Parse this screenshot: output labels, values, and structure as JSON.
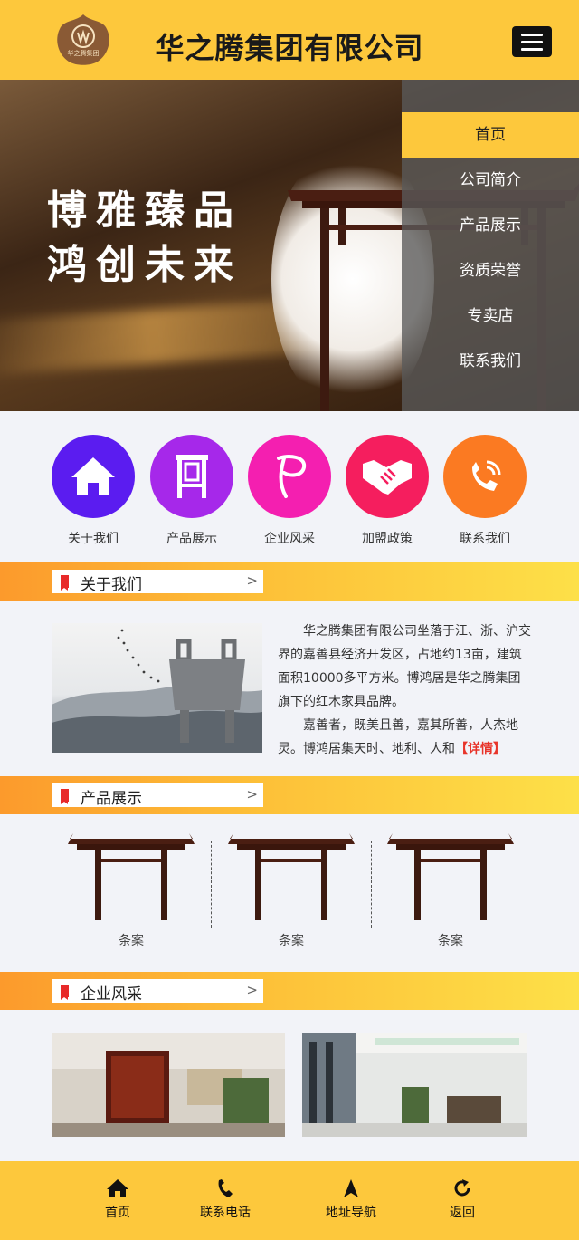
{
  "header": {
    "logo_text": "华之腾集团",
    "title": "华之腾集团有限公司",
    "menu_icon": "hamburger-menu-icon"
  },
  "banner": {
    "slogan_line1": "博雅臻品",
    "slogan_line2": "鸿创未来"
  },
  "nav": {
    "items": [
      {
        "label": "首页",
        "active": true
      },
      {
        "label": "公司简介"
      },
      {
        "label": "产品展示"
      },
      {
        "label": "资质荣誉"
      },
      {
        "label": "专卖店"
      },
      {
        "label": "联系我们"
      }
    ]
  },
  "quick_links": [
    {
      "label": "关于我们",
      "icon": "home-icon",
      "color": "#5b1cf0"
    },
    {
      "label": "产品展示",
      "icon": "chair-icon",
      "color": "#a628ea"
    },
    {
      "label": "企业风采",
      "icon": "brand-logo-icon",
      "color": "#f41fb0"
    },
    {
      "label": "加盟政策",
      "icon": "handshake-icon",
      "color": "#f51e5e"
    },
    {
      "label": "联系我们",
      "icon": "phone-icon",
      "color": "#fb7a22"
    }
  ],
  "sections": {
    "about": {
      "title": "关于我们",
      "para1": "华之腾集团有限公司坐落于江、浙、沪交界的嘉善县经济开发区，占地约13亩，建筑面积10000多平方米。博鸿居是华之腾集团旗下的红木家具品牌。",
      "para2": "嘉善者，既美且善，嘉其所善，人杰地灵。博鸿居集天时、地利、人和",
      "more": "【详情】"
    },
    "products": {
      "title": "产品展示",
      "items": [
        {
          "name": "条案"
        },
        {
          "name": "条案"
        },
        {
          "name": "条案"
        }
      ]
    },
    "culture": {
      "title": "企业风采"
    }
  },
  "footer": {
    "items": [
      {
        "label": "首页",
        "icon": "home-icon"
      },
      {
        "label": "联系电话",
        "icon": "phone-icon"
      },
      {
        "label": "地址导航",
        "icon": "navigation-arrow-icon"
      },
      {
        "label": "返回",
        "icon": "refresh-back-icon"
      }
    ]
  },
  "colors": {
    "brand_yellow": "#fdc83c",
    "accent_red": "#e8342a"
  }
}
